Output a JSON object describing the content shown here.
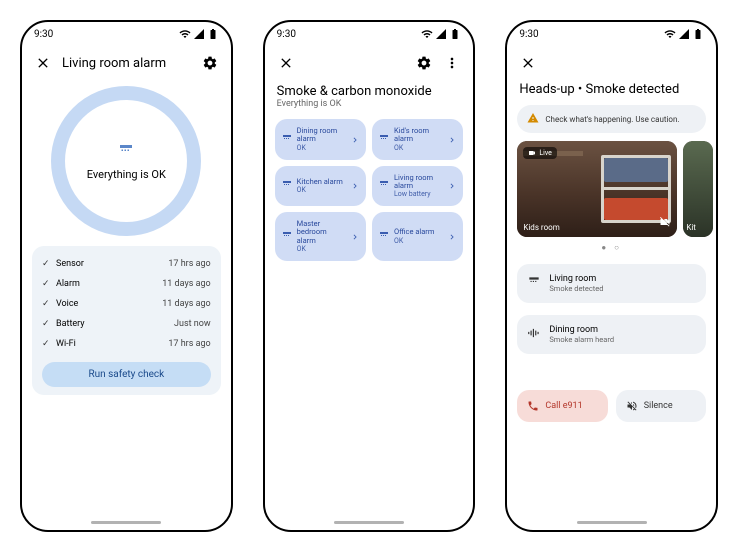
{
  "status_time": "9:30",
  "phone1": {
    "title": "Living room alarm",
    "ring_status": "Everything is OK",
    "checks": [
      {
        "label": "Sensor",
        "time": "17 hrs ago"
      },
      {
        "label": "Alarm",
        "time": "11 days ago"
      },
      {
        "label": "Voice",
        "time": "11 days ago"
      },
      {
        "label": "Battery",
        "time": "Just now"
      },
      {
        "label": "Wi-Fi",
        "time": "17 hrs ago"
      }
    ],
    "safety_button": "Run safety check"
  },
  "phone2": {
    "title": "Smoke & carbon monoxide",
    "subtitle": "Everything is OK",
    "alarms": [
      {
        "name": "Dining room alarm",
        "status": "OK"
      },
      {
        "name": "Kid's room alarm",
        "status": "OK"
      },
      {
        "name": "Kitchen alarm",
        "status": "OK"
      },
      {
        "name": "Living room alarm",
        "status": "Low battery"
      },
      {
        "name": "Master bedroom alarm",
        "status": "OK"
      },
      {
        "name": "Office alarm",
        "status": "OK"
      }
    ]
  },
  "phone3": {
    "title": "Heads-up • Smoke detected",
    "warning": "Check what's happening. Use caution.",
    "camera": {
      "live_label": "Live",
      "room_label": "Kids room",
      "partial_label": "Kit"
    },
    "alerts": [
      {
        "room": "Living room",
        "detail": "Smoke detected",
        "icon": "alarm"
      },
      {
        "room": "Dining room",
        "detail": "Smoke alarm heard",
        "icon": "sound"
      }
    ],
    "call_label": "Call e911",
    "silence_label": "Silence"
  }
}
